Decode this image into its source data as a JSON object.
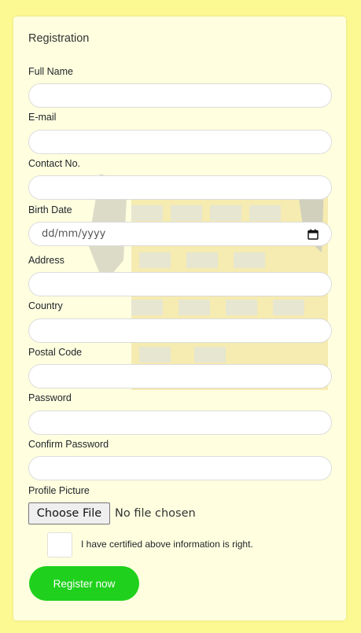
{
  "form": {
    "title": "Registration",
    "fields": [
      {
        "label": "Full Name",
        "value": ""
      },
      {
        "label": "E-mail",
        "value": ""
      },
      {
        "label": "Contact No.",
        "value": ""
      },
      {
        "label": "Birth Date",
        "placeholder": "dd/mm/yyyy"
      },
      {
        "label": "Address",
        "value": ""
      },
      {
        "label": "Country",
        "value": ""
      },
      {
        "label": "Postal Code",
        "value": ""
      },
      {
        "label": "Password",
        "value": ""
      },
      {
        "label": "Confirm Password",
        "value": ""
      }
    ],
    "profile_picture": {
      "label": "Profile Picture",
      "button_label": "Choose File",
      "status": "No file chosen"
    },
    "certify": {
      "label": "I have certified above information is right.",
      "checked": false
    },
    "submit_label": "Register now"
  },
  "icons": {
    "birth_date": "calendar-icon"
  },
  "colors": {
    "page_background": "#fdf992",
    "card_background": "#ffffe0",
    "submit_background": "#1fd11c",
    "submit_text": "#ffffff"
  }
}
